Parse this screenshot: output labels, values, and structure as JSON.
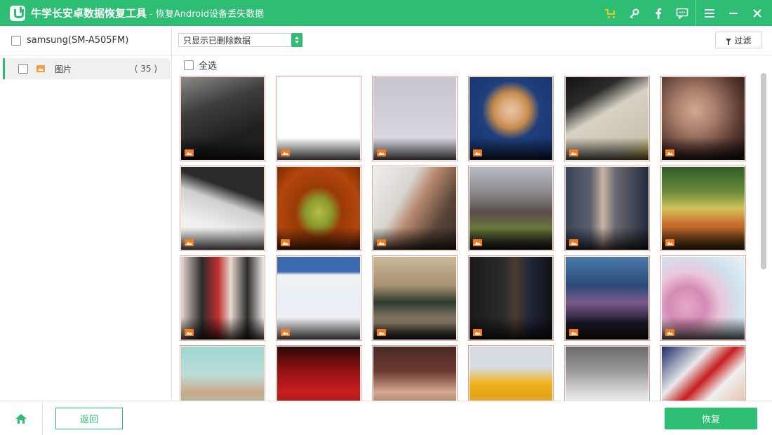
{
  "window": {
    "title": "牛学长安卓数据恢复工具",
    "subtitle": "- 恢复Android设备丢失数据",
    "icons": [
      "cart-icon",
      "key-icon",
      "facebook-icon",
      "feedback-icon",
      "menu-icon",
      "minimize-icon",
      "close-icon"
    ],
    "accent_color": "#2dbd73"
  },
  "sidebar": {
    "device": {
      "label": "samsung(SM-A505FM)",
      "checked": false
    },
    "categories": [
      {
        "label": "图片",
        "count": "( 35 )",
        "checked": false,
        "selected": true
      }
    ]
  },
  "toolbar": {
    "filter_select": {
      "value": "只显示已删除数据"
    },
    "filter_button": "过滤"
  },
  "grid": {
    "select_all_label": "全选",
    "thumbnails": [
      {
        "alt": "keyboard",
        "bg": "linear-gradient(160deg,#8a8a86 0%,#3d3e3c 35%,#1e1f1f 70%,#2a2b2a 100%)"
      },
      {
        "alt": "white",
        "bg": "#ffffff"
      },
      {
        "alt": "pale sky",
        "bg": "linear-gradient(180deg,#c9c5d1 0%,#d6d2dc 60%,#e2dfe6 100%)"
      },
      {
        "alt": "blonde woman portrait",
        "bg": "radial-gradient(circle at 50% 40%,#e8c7a8 0%,#d9a577 18%,#c48a4a 28%,#1f3f7d 45%,#13326a 100%)"
      },
      {
        "alt": "paper chart",
        "bg": "linear-gradient(150deg,#141414 0%,#2a2a2a 25%,#d7d2c3 45%,#c8c2b0 80%,#e3c24d 100%)"
      },
      {
        "alt": "dark skin closeup",
        "bg": "radial-gradient(circle at 40% 40%,#d2a893 0%,#a87d6a 30%,#5a3a32 65%,#1e1210 100%)"
      },
      {
        "alt": "black device on white",
        "bg": "linear-gradient(200deg,#2a2a2a 0%,#2a2a2a 30%,#cfcfcf 45%,#efefef 70%,#f7f7f7 100%)"
      },
      {
        "alt": "pickle",
        "bg": "radial-gradient(ellipse at 50% 55%,#b5bd4a 0%,#8a9a2c 22%,#9a3a08 40%,#b3460c 70%,#7a2a04 100%)"
      },
      {
        "alt": "man with glasses",
        "bg": "linear-gradient(120deg,#efefef 0%,#d9d4cf 35%,#b88a70 50%,#5a4438 75%,#3a322c 100%)"
      },
      {
        "alt": "crowd with flags",
        "bg": "linear-gradient(180deg,#b8bcc8 0%,#8c8c90 30%,#5a4c4a 55%,#6b7a3c 75%,#2a2a2a 100%)"
      },
      {
        "alt": "two men hearing",
        "bg": "linear-gradient(90deg,#3a4456 0%,#5a6070 30%,#c9b3a3 45%,#6a6a72 60%,#222a3a 100%)"
      },
      {
        "alt": "market produce",
        "bg": "linear-gradient(180deg,#2f5c28 0%,#6a8a3a 30%,#d4c25a 50%,#c86a2a 70%,#6a4a1a 100%)"
      },
      {
        "alt": "two women xs xl",
        "bg": "linear-gradient(90deg,#e8d8d0 0%,#2b2b2b 25%,#c23030 45%,#e8d8d0 60%,#2b2b2b 80%,#efe8e3 100%)"
      },
      {
        "alt": "website screenshot",
        "bg": "linear-gradient(180deg,#3c6ab0 0%,#3c6ab0 18%,#f2f2f2 22%,#e7eef5 50%,#f4f4f4 100%)"
      },
      {
        "alt": "woman sitting on floor",
        "bg": "linear-gradient(180deg,#c9b89a 0%,#a69070 35%,#2c3a2c 55%,#9a8a72 80%,#3a3a3a 100%)"
      },
      {
        "alt": "dark room man flag",
        "bg": "linear-gradient(90deg,#1a1a1a 0%,#2a2a2a 40%,#4a3a30 55%,#1e2438 75%,#121212 100%)"
      },
      {
        "alt": "dancer on stage",
        "bg": "linear-gradient(180deg,#4a7aa8 0%,#2a4a78 35%,#7a5a8a 55%,#1a1a2a 80%,#2a1a1a 100%)"
      },
      {
        "alt": "map of europe",
        "bg": "radial-gradient(circle at 30% 60%,#e5a9c8 0%,#d48ab4 25%,#eac7d9 45%,#cfe3ef 70%,#e9f1f6 100%)"
      },
      {
        "alt": "group of women",
        "bg": "linear-gradient(180deg,#9fd6d2 0%,#bcdcd4 35%,#c9a98a 55%,#a8c8c0 80%,#d6e8e2 100%)"
      },
      {
        "alt": "corruption sign",
        "bg": "linear-gradient(180deg,#2a0a0a 0%,#8a1010 25%,#c81e1e 55%,#5a0e0e 100%)"
      },
      {
        "alt": "woman and crowd",
        "bg": "linear-gradient(180deg,#4a2a26 0%,#6a3a30 30%,#d4a890 55%,#8a6a58 80%,#4a3a30 100%)"
      },
      {
        "alt": "golden arches",
        "bg": "linear-gradient(180deg,#d7dbe2 0%,#d7dbe2 25%,#f0b21a 45%,#e6a416 60%,#c9ccd2 80%,#9aa0a8 100%)"
      },
      {
        "alt": "factory cars",
        "bg": "linear-gradient(180deg,#6a6a6a 0%,#9a9a9a 30%,#d8d8d8 55%,#f0f0f0 70%,#8a8a8a 100%)"
      },
      {
        "alt": "flags and person",
        "bg": "linear-gradient(135deg,#1a2a6a 0%,#e8e8e8 30%,#c81e1e 45%,#f0f0f0 60%,#e6c8b8 80%,#3a2a6a 100%)"
      }
    ]
  },
  "footer": {
    "home_icon": "home-icon",
    "back_label": "返回",
    "recover_label": "恢复"
  }
}
